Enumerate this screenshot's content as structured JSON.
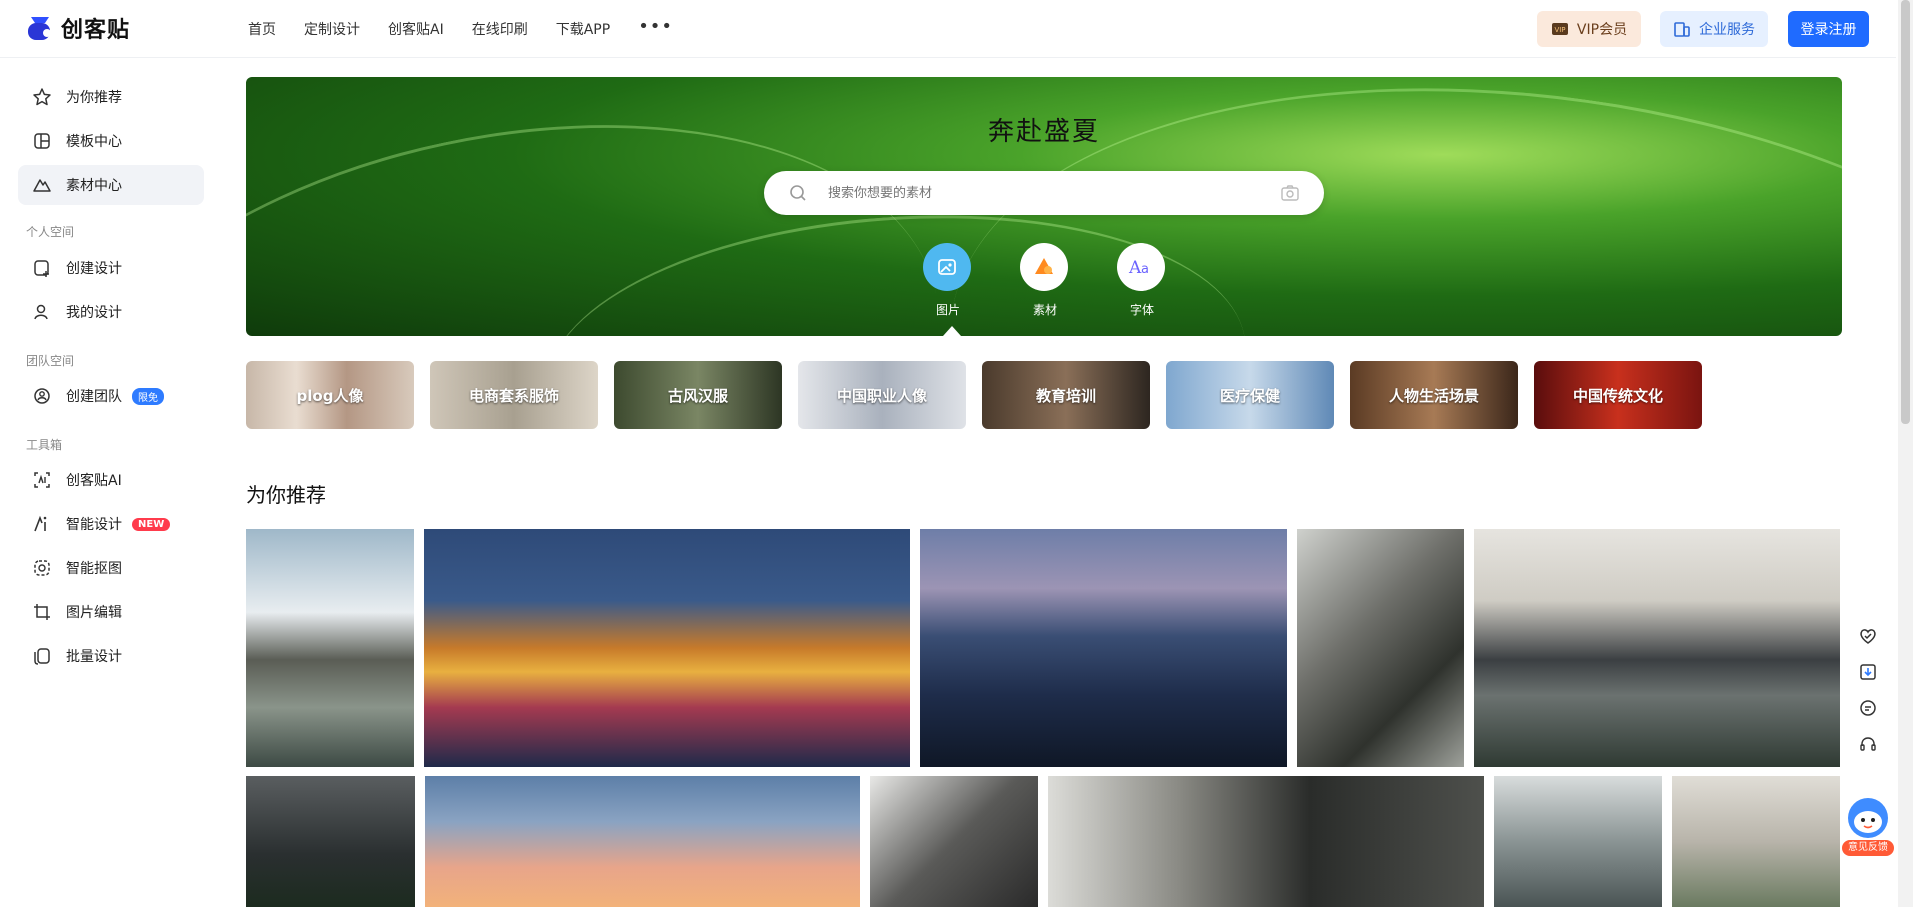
{
  "header": {
    "logo_text": "创客贴",
    "nav": [
      "首页",
      "定制设计",
      "创客贴AI",
      "在线印刷",
      "下载APP"
    ],
    "more": "•••",
    "vip_label": "VIP会员",
    "enterprise_label": "企业服务",
    "login_label": "登录注册",
    "colors": {
      "primary": "#1f6bff",
      "vip_bg": "#fbe9dc",
      "enterprise_bg": "#e6f0ff"
    }
  },
  "sidebar": {
    "main": [
      {
        "label": "为你推荐",
        "icon": "star-icon"
      },
      {
        "label": "模板中心",
        "icon": "template-icon"
      },
      {
        "label": "素材中心",
        "icon": "mountain-icon",
        "active": true
      }
    ],
    "personal_title": "个人空间",
    "personal": [
      {
        "label": "创建设计",
        "icon": "add-design-icon"
      },
      {
        "label": "我的设计",
        "icon": "user-icon"
      }
    ],
    "team_title": "团队空间",
    "team": [
      {
        "label": "创建团队",
        "icon": "team-icon",
        "badge": "限免"
      }
    ],
    "tools_title": "工具箱",
    "tools": [
      {
        "label": "创客贴AI",
        "icon": "ai-icon"
      },
      {
        "label": "智能设计",
        "icon": "smart-design-icon",
        "badge": "NEW"
      },
      {
        "label": "智能抠图",
        "icon": "cutout-icon"
      },
      {
        "label": "图片编辑",
        "icon": "crop-icon"
      },
      {
        "label": "批量设计",
        "icon": "batch-icon"
      }
    ]
  },
  "banner": {
    "title": "奔赴盛夏",
    "search_placeholder": "搜索你想要的素材",
    "categories": [
      {
        "label": "图片",
        "icon": "picture-icon",
        "color": "#4fb8f0"
      },
      {
        "label": "素材",
        "icon": "element-icon",
        "color": "#ff8a1f"
      },
      {
        "label": "字体",
        "icon": "font-icon",
        "color": "#6b63ff"
      }
    ]
  },
  "tags": [
    "plog人像",
    "电商套系服饰",
    "古风汉服",
    "中国职业人像",
    "教育培训",
    "医疗保健",
    "人物生活场景",
    "中国传统文化"
  ],
  "recommend_title": "为你推荐",
  "side_tools": [
    "heart-check-icon",
    "download-icon",
    "chat-icon",
    "headset-icon"
  ],
  "feedback_label": "意见反馈"
}
